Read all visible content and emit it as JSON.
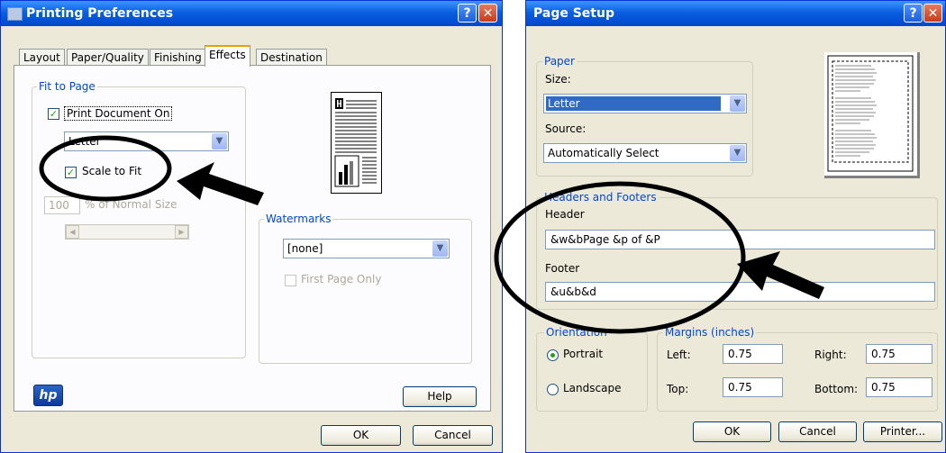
{
  "win1": {
    "title": "Printing Preferences",
    "tabs": [
      "Layout",
      "Paper/Quality",
      "Finishing",
      "Effects",
      "Destination"
    ],
    "fit_to_page": {
      "legend": "Fit to Page",
      "print_document_on_label": "Print Document On",
      "paper_select": "Letter",
      "scale_to_fit_label": "Scale to Fit",
      "scale_value": "100",
      "scale_label": "% of Normal Size"
    },
    "watermarks": {
      "legend": "Watermarks",
      "select_value": "[none]",
      "first_page_only_label": "First Page Only"
    },
    "logo_text": "hp",
    "buttons": {
      "help": "Help",
      "ok": "OK",
      "cancel": "Cancel"
    },
    "help_glyph": "?",
    "close_glyph": "✕"
  },
  "win2": {
    "title": "Page Setup",
    "paper": {
      "legend": "Paper",
      "size_label": "Size:",
      "size_value": "Letter",
      "source_label": "Source:",
      "source_value": "Automatically Select"
    },
    "headers_footers": {
      "legend": "Headers and Footers",
      "header_label": "Header",
      "header_value": "&w&bPage &p of &P",
      "footer_label": "Footer",
      "footer_value": "&u&b&d"
    },
    "orientation": {
      "legend": "Orientation",
      "portrait_label": "Portrait",
      "landscape_label": "Landscape"
    },
    "margins": {
      "legend": "Margins (inches)",
      "left_label": "Left:",
      "left_value": "0.75",
      "right_label": "Right:",
      "right_value": "0.75",
      "top_label": "Top:",
      "top_value": "0.75",
      "bottom_label": "Bottom:",
      "bottom_value": "0.75"
    },
    "buttons": {
      "ok": "OK",
      "cancel": "Cancel",
      "printer": "Printer..."
    },
    "help_glyph": "?",
    "close_glyph": "✕"
  },
  "colors": {
    "title_blue": "#0a5fe0",
    "legend_blue": "#0046d5",
    "selection_blue": "#316ac5",
    "check_green": "#21a121"
  }
}
